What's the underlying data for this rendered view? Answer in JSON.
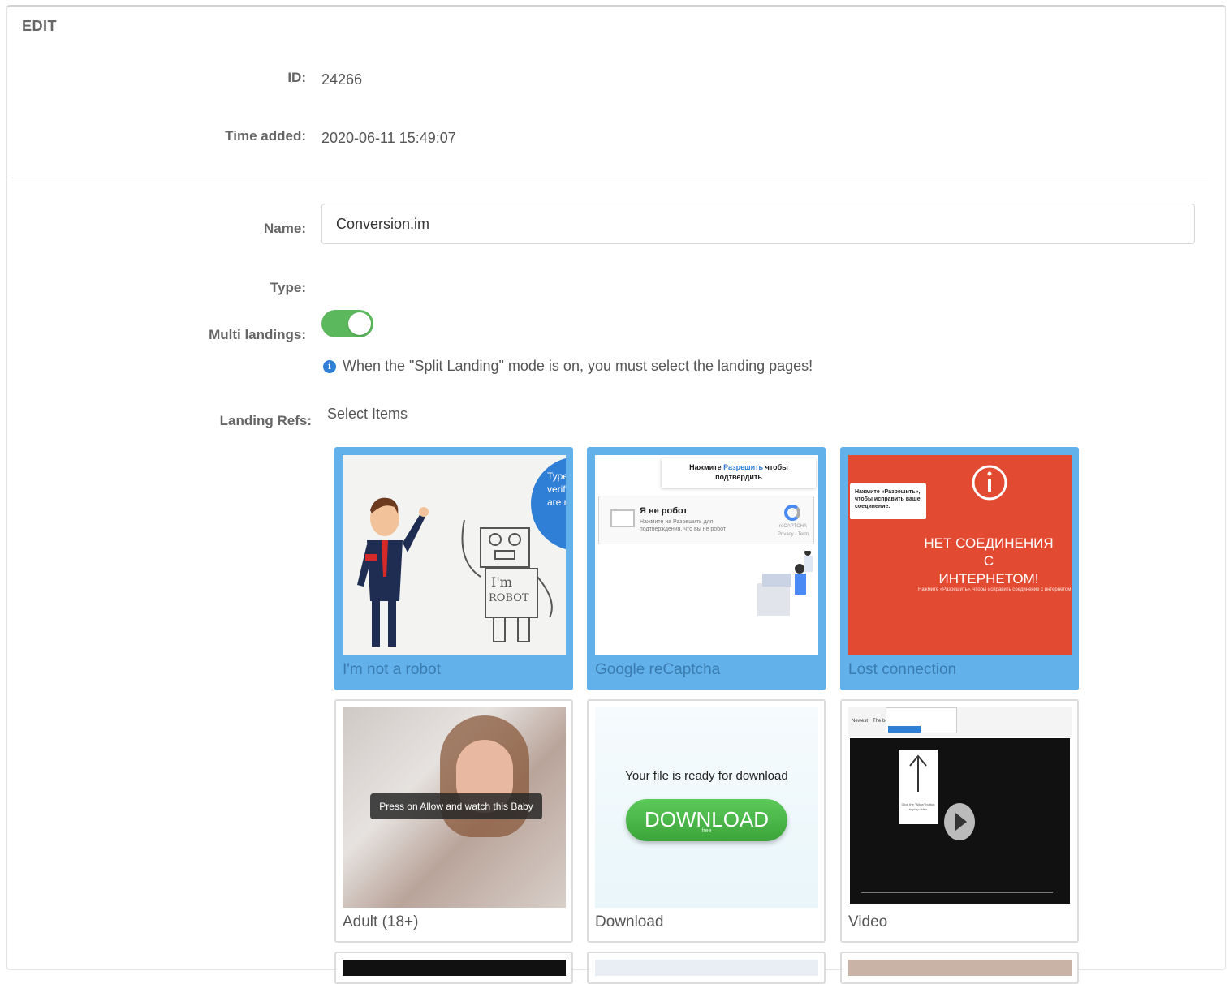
{
  "panel": {
    "title": "EDIT"
  },
  "info_section": {
    "id_label": "ID:",
    "id_value": "24266",
    "time_label": "Time added:",
    "time_value": "2020-06-11 15:49:07"
  },
  "form": {
    "name_label": "Name:",
    "name_value": "Conversion.im",
    "type_label": "Type:",
    "multi_label": "Multi landings:",
    "multi_on": true,
    "info_note": "When the \"Split Landing\" mode is on, you must select the landing pages!",
    "landing_refs_label": "Landing Refs:",
    "select_items_label": "Select Items"
  },
  "landings": [
    {
      "name": "I'm not a robot",
      "selected": true,
      "thumb_text": [
        "Type",
        "verif",
        "are r"
      ]
    },
    {
      "name": "Google reCaptcha",
      "selected": true,
      "thumb_text": [
        "Нажмите",
        "Разрешить",
        "чтобы",
        "подтвердить",
        "Я не робот",
        "Нажмите на Разрешить для",
        "подтверждения, что вы не робот",
        "reCAPTCHA",
        "Privacy - Term"
      ]
    },
    {
      "name": "Lost connection",
      "selected": true,
      "thumb_text": [
        "Нажмите «Разрешить»,",
        "чтобы исправить ваше",
        "соединение.",
        "НЕТ СОЕДИНЕНИЯ С",
        "ИНТЕРНЕТОМ!",
        "Нажмите «Разрешить», чтобы исправить соединение с интернетом"
      ]
    },
    {
      "name": "Adult (18+)",
      "selected": false,
      "thumb_text": [
        "Press on Allow and watch this Baby"
      ]
    },
    {
      "name": "Download",
      "selected": false,
      "thumb_text": [
        "Your file is ready for download",
        "DOWNLOAD",
        "free"
      ]
    },
    {
      "name": "Video",
      "selected": false,
      "thumb_text": [
        "Newest",
        "The best",
        "Click the \"Allow\" button",
        "to play video"
      ]
    }
  ],
  "colors": {
    "selected": "#62b1ea",
    "toggle_on": "#5cb85c",
    "info": "#2f7fd6",
    "lost_bg": "#e34a32",
    "download_btn": "#4cb848"
  }
}
